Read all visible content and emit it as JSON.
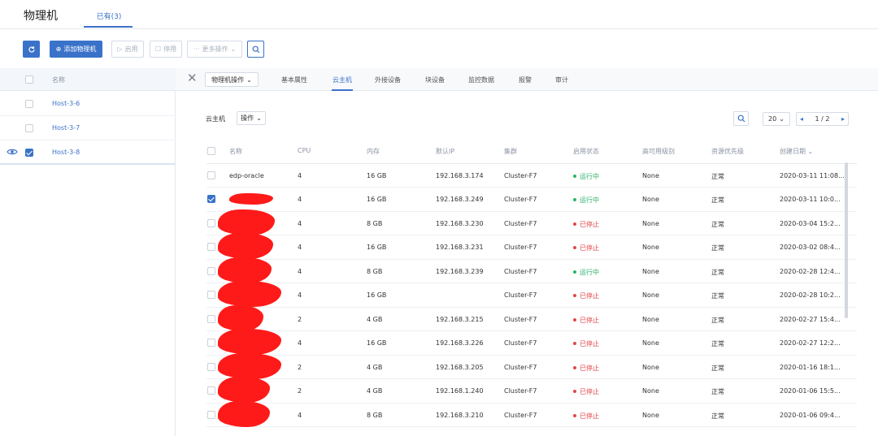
{
  "header": {
    "title": "物理机",
    "tab_label": "已有(3)"
  },
  "toolbar": {
    "add_label": "添加物理机",
    "enable_label": "启用",
    "disable_label": "停用",
    "more_label": "更多操作"
  },
  "hosts": {
    "column_name": "名称",
    "items": [
      {
        "name": "Host-3-6",
        "checked": false
      },
      {
        "name": "Host-3-7",
        "checked": false
      },
      {
        "name": "Host-3-8",
        "checked": true
      }
    ]
  },
  "detail": {
    "host_ops_label": "物理机操作",
    "tabs": [
      "基本属性",
      "云主机",
      "外接设备",
      "块设备",
      "监控数据",
      "报警",
      "审计"
    ],
    "active_tab": "云主机"
  },
  "vm_panel": {
    "label": "云主机",
    "ops_label": "操作",
    "page_size": "20",
    "page_indicator": "1 / 2"
  },
  "vm_table": {
    "columns": [
      "名称",
      "CPU",
      "内存",
      "默认IP",
      "集群",
      "启用状态",
      "高可用级别",
      "资源优先级",
      "创建日期"
    ],
    "rows": [
      {
        "name": "edp-oracle",
        "redacted": false,
        "checked": false,
        "cpu": "4",
        "mem": "16 GB",
        "ip": "192.168.3.174",
        "cluster": "Cluster-F7",
        "status": "运行中",
        "ha": "None",
        "priority": "正常",
        "created": "2020-03-11 11:08..."
      },
      {
        "name": "",
        "redacted": true,
        "checked": true,
        "cpu": "4",
        "mem": "16 GB",
        "ip": "192.168.3.249",
        "cluster": "Cluster-F7",
        "status": "运行中",
        "ha": "None",
        "priority": "正常",
        "created": "2020-03-11 10:0..."
      },
      {
        "name": "",
        "redacted": true,
        "checked": false,
        "cpu": "4",
        "mem": "8 GB",
        "ip": "192.168.3.230",
        "cluster": "Cluster-F7",
        "status": "已停止",
        "ha": "None",
        "priority": "正常",
        "created": "2020-03-04 15:2..."
      },
      {
        "name": "",
        "redacted": true,
        "checked": false,
        "cpu": "4",
        "mem": "16 GB",
        "ip": "192.168.3.231",
        "cluster": "Cluster-F7",
        "status": "已停止",
        "ha": "None",
        "priority": "正常",
        "created": "2020-03-02 08:4..."
      },
      {
        "name": "",
        "redacted": true,
        "checked": false,
        "cpu": "4",
        "mem": "8 GB",
        "ip": "192.168.3.239",
        "cluster": "Cluster-F7",
        "status": "运行中",
        "ha": "None",
        "priority": "正常",
        "created": "2020-02-28 12:4..."
      },
      {
        "name": "",
        "redacted": true,
        "checked": false,
        "cpu": "4",
        "mem": "16 GB",
        "ip": "",
        "cluster": "Cluster-F7",
        "status": "已停止",
        "ha": "None",
        "priority": "正常",
        "created": "2020-02-28 10:2..."
      },
      {
        "name": "",
        "redacted": true,
        "checked": false,
        "cpu": "2",
        "mem": "4 GB",
        "ip": "192.168.3.215",
        "cluster": "Cluster-F7",
        "status": "已停止",
        "ha": "None",
        "priority": "正常",
        "created": "2020-02-27 15:4..."
      },
      {
        "name": "",
        "redacted": true,
        "checked": false,
        "cpu": "4",
        "mem": "16 GB",
        "ip": "192.168.3.226",
        "cluster": "Cluster-F7",
        "status": "已停止",
        "ha": "None",
        "priority": "正常",
        "created": "2020-02-27 12:2..."
      },
      {
        "name": "",
        "redacted": true,
        "checked": false,
        "cpu": "2",
        "mem": "4 GB",
        "ip": "192.168.3.205",
        "cluster": "Cluster-F7",
        "status": "已停止",
        "ha": "None",
        "priority": "正常",
        "created": "2020-01-16 18:1..."
      },
      {
        "name": "",
        "redacted": true,
        "checked": false,
        "cpu": "2",
        "mem": "4 GB",
        "ip": "192.168.1.240",
        "cluster": "Cluster-F7",
        "status": "已停止",
        "ha": "None",
        "priority": "正常",
        "created": "2020-01-06 15:5..."
      },
      {
        "name": "",
        "redacted": true,
        "checked": false,
        "cpu": "4",
        "mem": "8 GB",
        "ip": "192.168.3.210",
        "cluster": "Cluster-F7",
        "status": "已停止",
        "ha": "None",
        "priority": "正常",
        "created": "2020-01-06 09:4..."
      }
    ]
  },
  "colors": {
    "accent": "#3a72c9",
    "running": "#2fb36b",
    "stopped": "#e0474c",
    "redaction": "#ff1a1a"
  }
}
